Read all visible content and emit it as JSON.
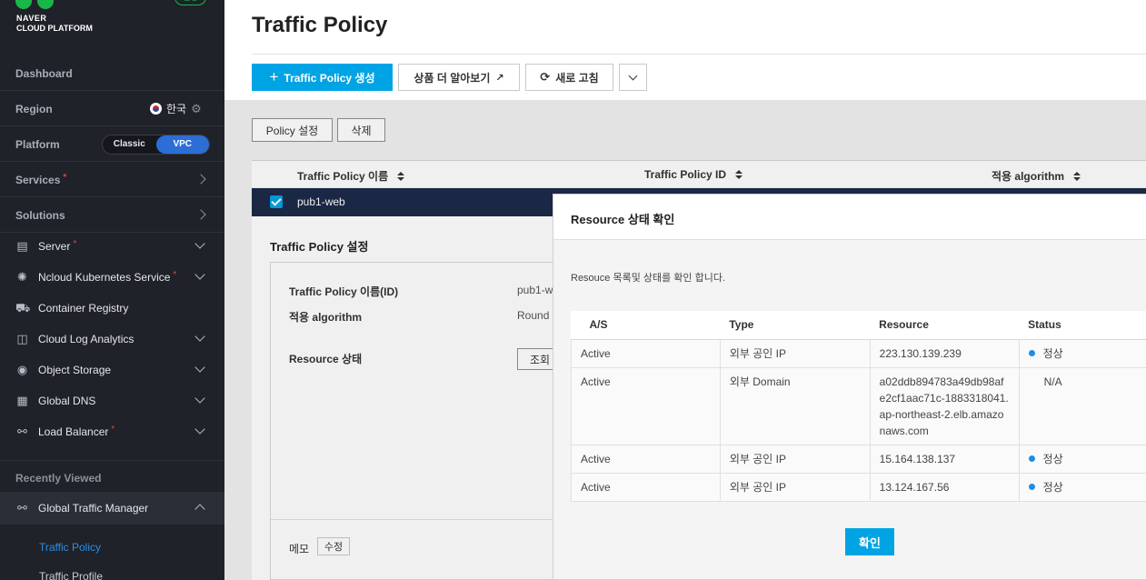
{
  "brand": {
    "line1": "NAVER",
    "line2": "CLOUD PLATFORM",
    "badge": "신청"
  },
  "sidebar": {
    "dashboard": "Dashboard",
    "region_label": "Region",
    "region_value": "한국",
    "platform_label": "Platform",
    "platform_options": [
      "Classic",
      "VPC"
    ],
    "services_label": "Services",
    "solutions_label": "Solutions",
    "services": [
      {
        "label": "Server",
        "icon": "server-icon",
        "new": true
      },
      {
        "label": "Ncloud Kubernetes Service",
        "icon": "kubernetes-icon",
        "new": true
      },
      {
        "label": "Container Registry",
        "icon": "container-registry-icon",
        "new": false
      },
      {
        "label": "Cloud Log Analytics",
        "icon": "log-analytics-icon",
        "new": false
      },
      {
        "label": "Object Storage",
        "icon": "storage-icon",
        "new": false
      },
      {
        "label": "Global DNS",
        "icon": "dns-icon",
        "new": false
      },
      {
        "label": "Load Balancer",
        "icon": "load-balancer-icon",
        "new": true
      }
    ],
    "recently_viewed": "Recently Viewed",
    "gtm_label": "Global Traffic Manager",
    "sub_items": [
      "Traffic Policy",
      "Traffic Profile"
    ]
  },
  "page": {
    "title": "Traffic Policy",
    "create_button": "Traffic Policy 생성",
    "learn_more": "상품 더 알아보기",
    "refresh": "새로 고침",
    "policy_settings": "Policy 설정",
    "delete": "삭제"
  },
  "table": {
    "headers": [
      "Traffic Policy 이름",
      "Traffic Policy ID",
      "적용 algorithm"
    ],
    "row_name": "pub1-web"
  },
  "detail": {
    "title": "Traffic Policy 설정",
    "name_label": "Traffic Policy 이름(ID)",
    "name_value": "pub1-w",
    "algorithm_label": "적용 algorithm",
    "algorithm_value": "Round I",
    "resource_label": "Resource 상태",
    "lookup_button": "조회",
    "memo_label": "메모",
    "memo_edit": "수정"
  },
  "modal": {
    "title": "Resource 상태 확인",
    "description": "Resouce 목록및 상태를 확인 합니다.",
    "headers": [
      "A/S",
      "Type",
      "Resource",
      "Status"
    ],
    "rows": [
      {
        "as": "Active",
        "type": "외부 공인 IP",
        "resource": "223.130.139.239",
        "status": "정상",
        "dot": true
      },
      {
        "as": "Active",
        "type": "외부 Domain",
        "resource": "a02ddb894783a49db98af e2cf1aac71c-1883318041.ap-northeast-2.elb.amazonaws.com",
        "status": "N/A",
        "dot": false
      },
      {
        "as": "Active",
        "type": "외부 공인 IP",
        "resource": "15.164.138.137",
        "status": "정상",
        "dot": true
      },
      {
        "as": "Active",
        "type": "외부 공인 IP",
        "resource": "13.124.167.56",
        "status": "정상",
        "dot": true
      }
    ],
    "confirm": "확인"
  },
  "colors": {
    "accent": "#00a4e4",
    "sidebar_bg": "#1f2229",
    "vpc_active": "#2c6ed5",
    "status_dot": "#1a8fe8",
    "brand_green": "#19b64a"
  }
}
